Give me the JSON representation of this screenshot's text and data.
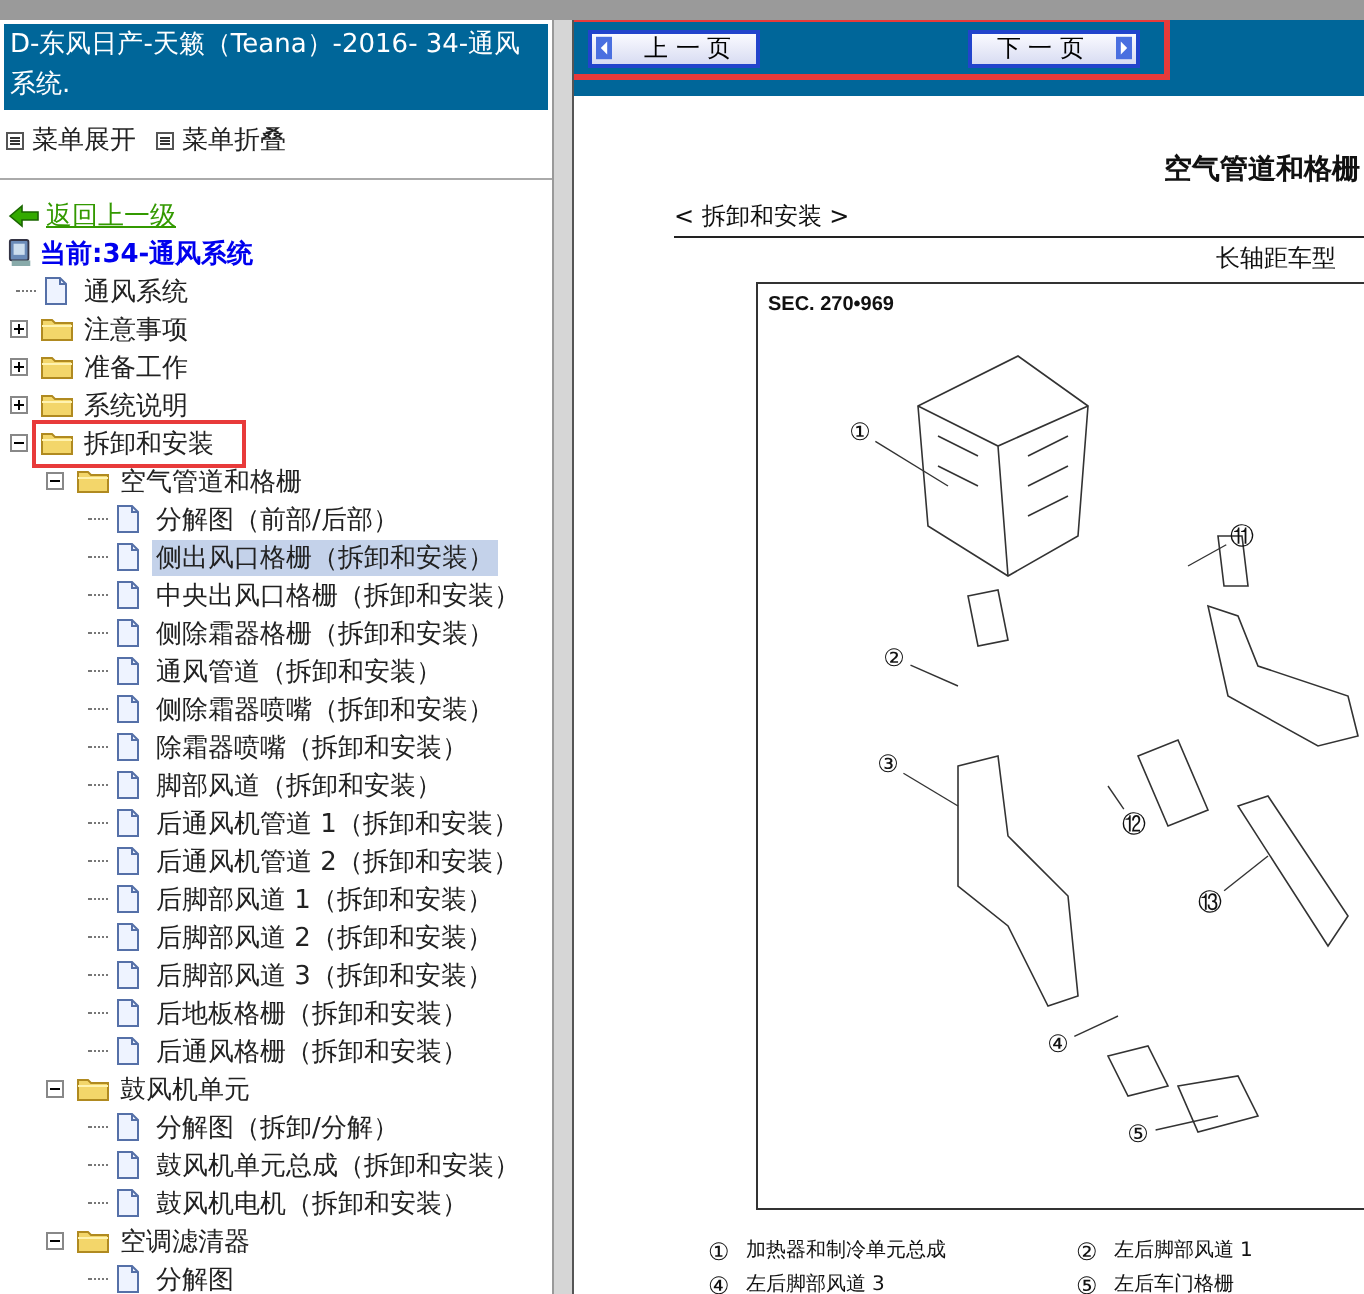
{
  "left_panel": {
    "title": "D-东风日产-天籁（Teana）-2016- 34-通风系统.",
    "menu_actions": [
      "菜单展开",
      "菜单折叠"
    ],
    "back_link": "返回上一级",
    "tree": {
      "root": "当前:34-通风系统",
      "items": [
        {
          "label": "通风系统",
          "kind": "document",
          "selected": false,
          "boxed": false
        },
        {
          "label": "注意事项",
          "kind": "folder",
          "expanded": false,
          "selected": false,
          "boxed": false
        },
        {
          "label": "准备工作",
          "kind": "folder",
          "expanded": false,
          "selected": false,
          "boxed": false
        },
        {
          "label": "系统说明",
          "kind": "folder",
          "expanded": false,
          "selected": false,
          "boxed": false
        },
        {
          "label": "拆卸和安装",
          "kind": "folder",
          "expanded": true,
          "selected": false,
          "boxed": true,
          "children": [
            {
              "label": "空气管道和格栅",
              "kind": "folder",
              "expanded": true,
              "selected": false,
              "boxed": false,
              "children": [
                {
                  "label": "分解图（前部/后部）",
                  "kind": "document",
                  "selected": false,
                  "boxed": false
                },
                {
                  "label": "侧出风口格栅（拆卸和安装）",
                  "kind": "document",
                  "selected": true,
                  "boxed": false
                },
                {
                  "label": "中央出风口格栅（拆卸和安装）",
                  "kind": "document",
                  "selected": false,
                  "boxed": false
                },
                {
                  "label": "侧除霜器格栅（拆卸和安装）",
                  "kind": "document",
                  "selected": false,
                  "boxed": false
                },
                {
                  "label": "通风管道（拆卸和安装）",
                  "kind": "document",
                  "selected": false,
                  "boxed": false
                },
                {
                  "label": "侧除霜器喷嘴（拆卸和安装）",
                  "kind": "document",
                  "selected": false,
                  "boxed": false
                },
                {
                  "label": "除霜器喷嘴（拆卸和安装）",
                  "kind": "document",
                  "selected": false,
                  "boxed": false
                },
                {
                  "label": "脚部风道（拆卸和安装）",
                  "kind": "document",
                  "selected": false,
                  "boxed": false
                },
                {
                  "label": "后通风机管道 1（拆卸和安装）",
                  "kind": "document",
                  "selected": false,
                  "boxed": false
                },
                {
                  "label": "后通风机管道 2（拆卸和安装）",
                  "kind": "document",
                  "selected": false,
                  "boxed": false
                },
                {
                  "label": "后脚部风道 1（拆卸和安装）",
                  "kind": "document",
                  "selected": false,
                  "boxed": false
                },
                {
                  "label": "后脚部风道 2（拆卸和安装）",
                  "kind": "document",
                  "selected": false,
                  "boxed": false
                },
                {
                  "label": "后脚部风道 3（拆卸和安装）",
                  "kind": "document",
                  "selected": false,
                  "boxed": false
                },
                {
                  "label": "后地板格栅（拆卸和安装）",
                  "kind": "document",
                  "selected": false,
                  "boxed": false
                },
                {
                  "label": "后通风格栅（拆卸和安装）",
                  "kind": "document",
                  "selected": false,
                  "boxed": false
                }
              ]
            },
            {
              "label": "鼓风机单元",
              "kind": "folder",
              "expanded": true,
              "selected": false,
              "boxed": false,
              "children": [
                {
                  "label": "分解图（拆卸/分解）",
                  "kind": "document",
                  "selected": false,
                  "boxed": false
                },
                {
                  "label": "鼓风机单元总成（拆卸和安装）",
                  "kind": "document",
                  "selected": false,
                  "boxed": false
                },
                {
                  "label": "鼓风机电机（拆卸和安装）",
                  "kind": "document",
                  "selected": false,
                  "boxed": false
                }
              ]
            },
            {
              "label": "空调滤清器",
              "kind": "folder",
              "expanded": true,
              "selected": false,
              "boxed": false,
              "children": [
                {
                  "label": "分解图",
                  "kind": "document",
                  "selected": false,
                  "boxed": false
                }
              ]
            }
          ]
        }
      ]
    }
  },
  "toolbar": {
    "boxed": true,
    "buttons": [
      {
        "label": "上 一 页",
        "kind": "prev"
      },
      {
        "label": "下 一 页",
        "kind": "next"
      }
    ]
  },
  "document": {
    "title": "空气管道和格栅",
    "section": "< 拆卸和安装 >",
    "subtitle": "长轴距车型",
    "figure": {
      "code": "SEC. 270•969",
      "callouts": [
        "①",
        "⑪",
        "②",
        "③",
        "⑫",
        "⑬",
        "④",
        "⑤"
      ]
    },
    "legend": [
      {
        "number": "①",
        "text": "加热器和制冷单元总成"
      },
      {
        "number": "②",
        "text": "左后脚部风道 1"
      },
      {
        "number": "④",
        "text": "左后脚部风道 3"
      },
      {
        "number": "⑤",
        "text": "左后车门格栅"
      }
    ]
  }
}
